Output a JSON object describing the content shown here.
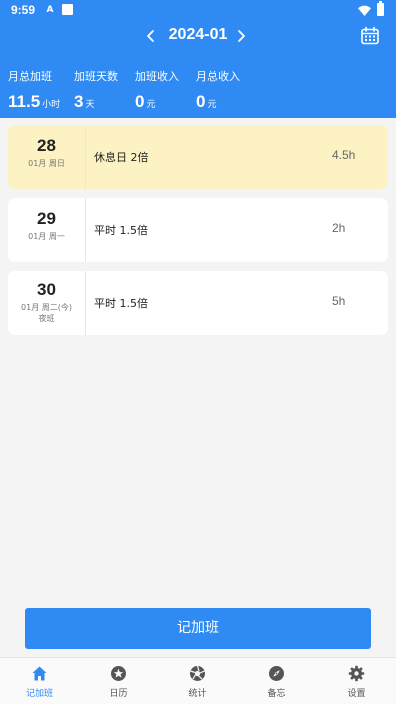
{
  "status_bar": {
    "time": "9:59",
    "notif_glyph": "A",
    "icons": [
      "notification-a-icon",
      "notification-square-icon",
      "wifi-icon",
      "battery-icon"
    ]
  },
  "header": {
    "month": "2024-01",
    "prev_icon": "chevron-left-icon",
    "next_icon": "chevron-right-icon",
    "calendar_icon": "calendar-icon",
    "background_color": "#2f8bf3"
  },
  "stats": [
    {
      "label": "月总加班",
      "value": "11.5",
      "unit": "小时"
    },
    {
      "label": "加班天数",
      "value": "3",
      "unit": "天"
    },
    {
      "label": "加班收入",
      "value": "0",
      "unit": "元"
    },
    {
      "label": "月总收入",
      "value": "0",
      "unit": "元"
    }
  ],
  "records": [
    {
      "day": "28",
      "week": "01月 周日",
      "sub": "",
      "type": "休息日 2倍",
      "hours": "4.5h",
      "highlight": true,
      "highlight_color": "#fdf2c4"
    },
    {
      "day": "29",
      "week": "01月 周一",
      "sub": "",
      "type": "平时 1.5倍",
      "hours": "2h",
      "highlight": false
    },
    {
      "day": "30",
      "week": "01月 周二(今)",
      "sub": "夜班",
      "type": "平时 1.5倍",
      "hours": "5h",
      "highlight": false
    }
  ],
  "add_button": {
    "label": "记加班"
  },
  "bottom_nav": {
    "active_color": "#2f8bf3",
    "items": [
      {
        "label": "记加班",
        "icon": "home-icon",
        "active": true
      },
      {
        "label": "日历",
        "icon": "star-icon",
        "active": false
      },
      {
        "label": "统计",
        "icon": "aperture-icon",
        "active": false
      },
      {
        "label": "备忘",
        "icon": "compass-icon",
        "active": false
      },
      {
        "label": "设置",
        "icon": "gear-icon",
        "active": false
      }
    ]
  }
}
